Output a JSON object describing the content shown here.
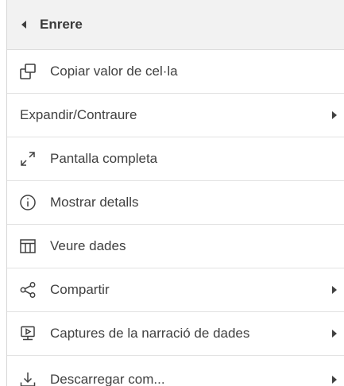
{
  "menu": {
    "back": {
      "label": "Enrere",
      "icon": "back-arrow-icon"
    },
    "items": [
      {
        "id": "copy-cell-value",
        "label": "Copiar valor de cel·la",
        "icon": "copy-icon",
        "submenu": false
      },
      {
        "id": "expand-collapse",
        "label": "Expandir/Contraure",
        "icon": null,
        "submenu": true
      },
      {
        "id": "fullscreen",
        "label": "Pantalla completa",
        "icon": "expand-icon",
        "submenu": false
      },
      {
        "id": "show-details",
        "label": "Mostrar detalls",
        "icon": "info-icon",
        "submenu": false
      },
      {
        "id": "view-data",
        "label": "Veure dades",
        "icon": "table-icon",
        "submenu": false
      },
      {
        "id": "share",
        "label": "Compartir",
        "icon": "share-icon",
        "submenu": true
      },
      {
        "id": "data-storytelling-snapshots",
        "label": "Captures de la narració de dades",
        "icon": "snapshot-icon",
        "submenu": true
      },
      {
        "id": "download-as",
        "label": "Descarregar com...",
        "icon": "download-icon",
        "submenu": true
      }
    ]
  },
  "colors": {
    "text": "#404040",
    "header_bg": "#f2f2f2",
    "divider": "#e2e2e2"
  }
}
